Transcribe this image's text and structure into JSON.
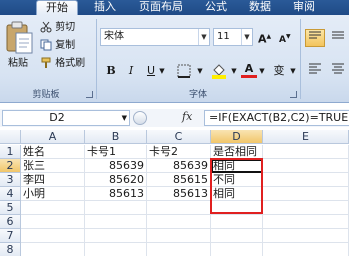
{
  "tabs": [
    {
      "label": "开始",
      "active": true
    },
    {
      "label": "插入"
    },
    {
      "label": "页面布局"
    },
    {
      "label": "公式"
    },
    {
      "label": "数据"
    },
    {
      "label": "审阅"
    }
  ],
  "ribbon": {
    "clipboard": {
      "paste_label": "粘贴",
      "cut_label": "剪切",
      "copy_label": "复制",
      "format_painter_label": "格式刷",
      "group_label": "剪贴板"
    },
    "font": {
      "font_name": "宋体",
      "font_size": "11",
      "grow_label": "A",
      "shrink_label": "A",
      "bold_label": "B",
      "italic_label": "I",
      "underline_label": "U",
      "phonetic_label": "变",
      "color_label": "A",
      "group_label": "字体"
    }
  },
  "formula_bar": {
    "name_box": "D2",
    "fx_label": "fx",
    "formula": "=IF(EXACT(B2,C2)=TRUE"
  },
  "sheet": {
    "columns": [
      "A",
      "B",
      "C",
      "D",
      "E"
    ],
    "rows": [
      "1",
      "2",
      "3",
      "4",
      "5",
      "6",
      "7",
      "8"
    ],
    "cells": {
      "A1": "姓名",
      "B1": "卡号1",
      "C1": "卡号2",
      "D1": "是否相同",
      "A2": "张三",
      "B2": "85639",
      "C2": "85639",
      "D2": "相同",
      "A3": "李四",
      "B3": "85620",
      "C3": "85615",
      "D3": "不同",
      "A4": "小明",
      "B4": "85613",
      "C4": "85613",
      "D4": "相同"
    },
    "selected_cell": "D2",
    "highlight_color": "#e02020"
  }
}
